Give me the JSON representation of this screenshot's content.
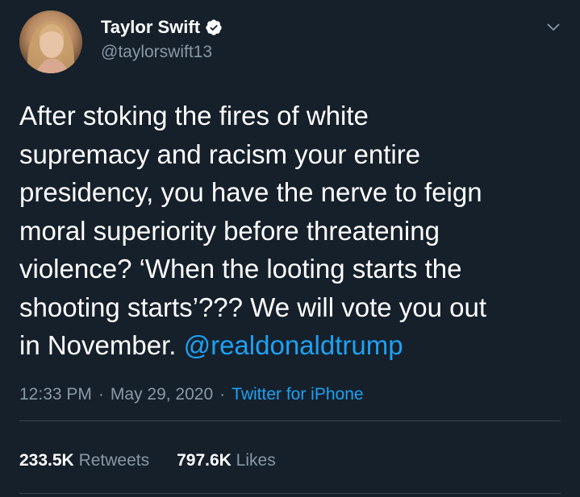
{
  "author": {
    "name": "Taylor Swift",
    "handle": "@taylorswift13",
    "verified_icon": "verified-badge-icon"
  },
  "tweet": {
    "text": "After stoking the fires of white\nsupremacy and racism your entire\npresidency, you have the nerve to feign\nmoral superiority before threatening\nviolence? ‘When the looting starts the\nshooting starts’??? We will vote you out\nin November. ",
    "mention": "@realdonaldtrump"
  },
  "meta": {
    "time": "12:33 PM",
    "separator": "·",
    "date": "May 29, 2020",
    "source": "Twitter for iPhone"
  },
  "stats": {
    "retweets_count": "233.5K",
    "retweets_label": "Retweets",
    "likes_count": "797.6K",
    "likes_label": "Likes"
  },
  "colors": {
    "background": "#15202b",
    "link": "#1da1f2",
    "secondary_text": "#8899a6"
  }
}
